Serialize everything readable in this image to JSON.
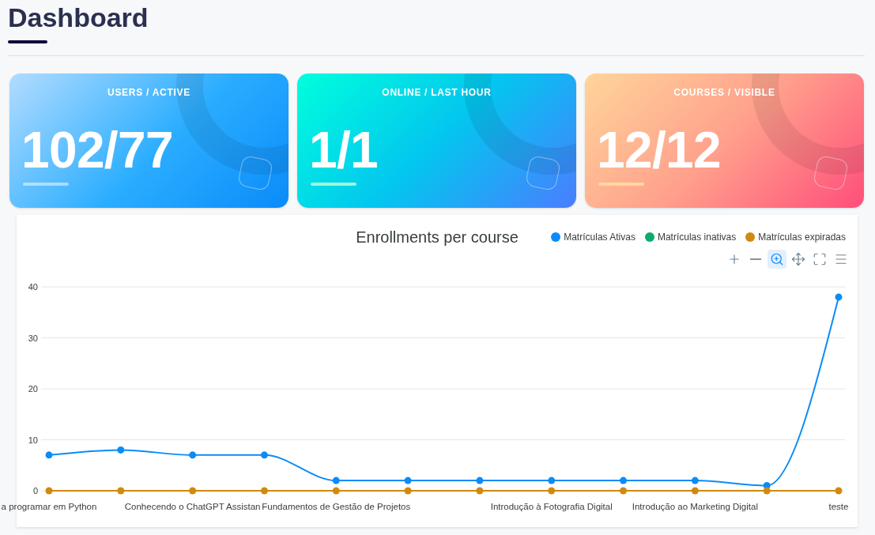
{
  "page": {
    "title": "Dashboard"
  },
  "stats": [
    {
      "label": "USERS / ACTIVE",
      "value": "102/77"
    },
    {
      "label": "ONLINE / LAST HOUR",
      "value": "1/1"
    },
    {
      "label": "COURSES / VISIBLE",
      "value": "12/12"
    }
  ],
  "chart": {
    "toolbar": [
      {
        "kind": "zoom-in",
        "selected": false
      },
      {
        "kind": "zoom-out",
        "selected": false
      },
      {
        "kind": "zoom",
        "selected": true
      },
      {
        "kind": "pan",
        "selected": false
      },
      {
        "kind": "expand",
        "selected": false
      },
      {
        "kind": "menu",
        "selected": false
      }
    ],
    "chart_data": {
      "type": "line",
      "title": "Enrollments per course",
      "legend": "top",
      "grid": true,
      "categories": [
        "a programar em Python",
        null,
        "Conhecendo o ChatGPT Assistan",
        null,
        "Fundamentos de Gestão de Projetos",
        null,
        null,
        "Introdução à Fotografia Digital",
        null,
        "Introdução ao Marketing Digital",
        null,
        "teste"
      ],
      "ylim": [
        0,
        40
      ],
      "yticks": [
        0,
        10,
        20,
        30,
        40
      ],
      "series": [
        {
          "name": "Matrículas Ativas",
          "color": "#0a8cf8",
          "marker": "circle",
          "values": [
            7,
            8,
            7,
            7,
            2,
            2,
            2,
            2,
            2,
            2,
            1,
            38
          ]
        },
        {
          "name": "Matrículas inativas",
          "color": "#0eaa6c",
          "marker": "circle",
          "values": [
            null,
            null,
            null,
            null,
            null,
            null,
            null,
            null,
            null,
            null,
            null,
            null
          ]
        },
        {
          "name": "Matrículas expiradas",
          "color": "#d1890f",
          "marker": "circle",
          "values": [
            0,
            0,
            0,
            0,
            0,
            0,
            0,
            0,
            0,
            0,
            0,
            0
          ]
        }
      ]
    }
  }
}
